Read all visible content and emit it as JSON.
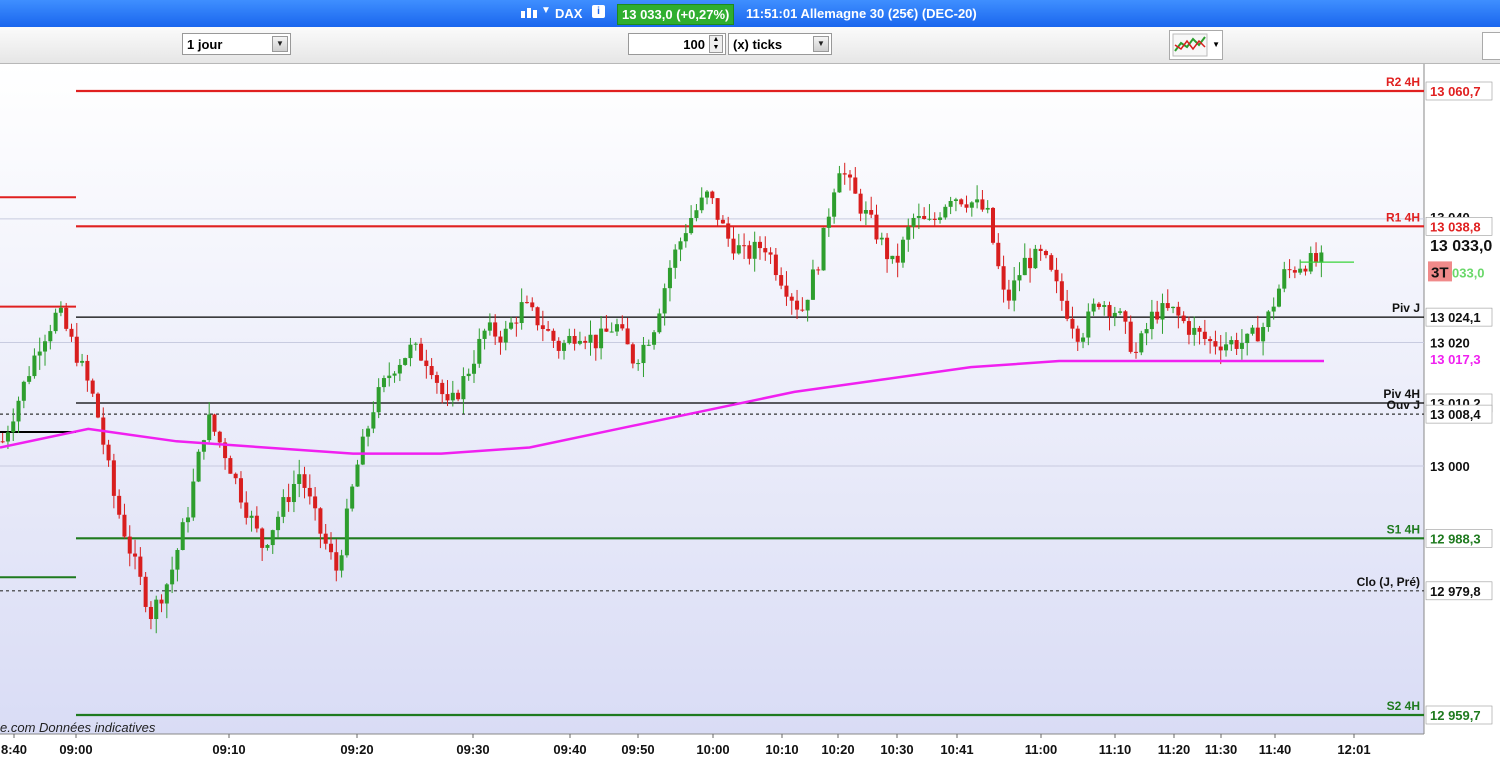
{
  "titlebar": {
    "symbol": "DAX",
    "info_icon": "info-icon",
    "price_badge": "13 033,0 (+0,27%)",
    "time_and_name": "11:51:01 Allemagne 30 (25€) (DEC-20)",
    "color": "#1a66ee"
  },
  "toolbar": {
    "period": "1 jour",
    "tick_count": "100",
    "unit": "(x) ticks"
  },
  "footer_note": "e.com Données indicatives",
  "colors": {
    "bull": "#2e9e2e",
    "bear": "#d81e1e",
    "resistance": "#e02020",
    "support": "#1e7a1e",
    "vwap": "#f020f0",
    "pivot": "#000000"
  },
  "chart_data": {
    "type": "candlestick",
    "y_range": [
      12953,
      13066
    ],
    "x_tick_labels": [
      "8:40",
      "09:00",
      "09:10",
      "09:20",
      "09:30",
      "09:40",
      "09:50",
      "10:00",
      "10:10",
      "10:20",
      "10:30",
      "10:41",
      "11:00",
      "11:10",
      "11:20",
      "11:30",
      "11:40",
      "12:01"
    ],
    "y_tick_labels": [
      "13 020",
      "13 000"
    ],
    "last_price_label": "13 033,0",
    "last_badge_small": "3T",
    "last_badge_value": "033,0",
    "levels": [
      {
        "label": "R2 4H",
        "value": "13 060,7",
        "price": 13060.7,
        "style": "resistance"
      },
      {
        "label": "R1 4H",
        "value": "13 038,8",
        "price": 13038.8,
        "style": "resistance"
      },
      {
        "label": "Piv J",
        "value": "13 024,1",
        "price": 13024.1,
        "style": "pivot"
      },
      {
        "label": "Piv 4H",
        "value": "13 010,2",
        "price": 13010.2,
        "style": "pivot"
      },
      {
        "label": "Ouv J",
        "value": "13 008,4",
        "price": 13008.4,
        "style": "dotted"
      },
      {
        "label": "S1 4H",
        "value": "12 988,3",
        "price": 12988.3,
        "style": "support"
      },
      {
        "label": "Clo (J, Pré)",
        "value": "12 979,8",
        "price": 12979.8,
        "style": "dotted"
      },
      {
        "label": "S2 4H",
        "value": "12 959,7",
        "price": 12959.7,
        "style": "support"
      }
    ],
    "vwap_value": "13 017,3",
    "hidden_axis_label": "13 040",
    "price_path": [
      13004,
      13012,
      13020,
      13025,
      13018,
      13010,
      12995,
      12985,
      12976,
      12982,
      12993,
      13008,
      13002,
      12994,
      12987,
      12993,
      12999,
      12990,
      12983,
      12999,
      13010,
      13016,
      13019,
      13017,
      13009,
      13015,
      13022,
      13021,
      13026,
      13023,
      13019,
      13022,
      13020,
      13023,
      13017,
      13022,
      13033,
      13040,
      13044,
      13037,
      13034,
      13036,
      13030,
      13025,
      13034,
      13049,
      13043,
      13038,
      13032,
      13040,
      13039,
      13044,
      13043,
      13041,
      13026,
      13033,
      13034,
      13027,
      13021,
      13027,
      13025,
      13018,
      13025,
      13025,
      13022,
      13020,
      13020,
      13020,
      13023,
      13031,
      13033,
      13033
    ],
    "vwap_path": [
      13003,
      13006,
      13004,
      13003,
      13002,
      13002,
      13003,
      13006,
      13009,
      13012,
      13014,
      13016,
      13017,
      13017,
      13017,
      13017
    ]
  }
}
